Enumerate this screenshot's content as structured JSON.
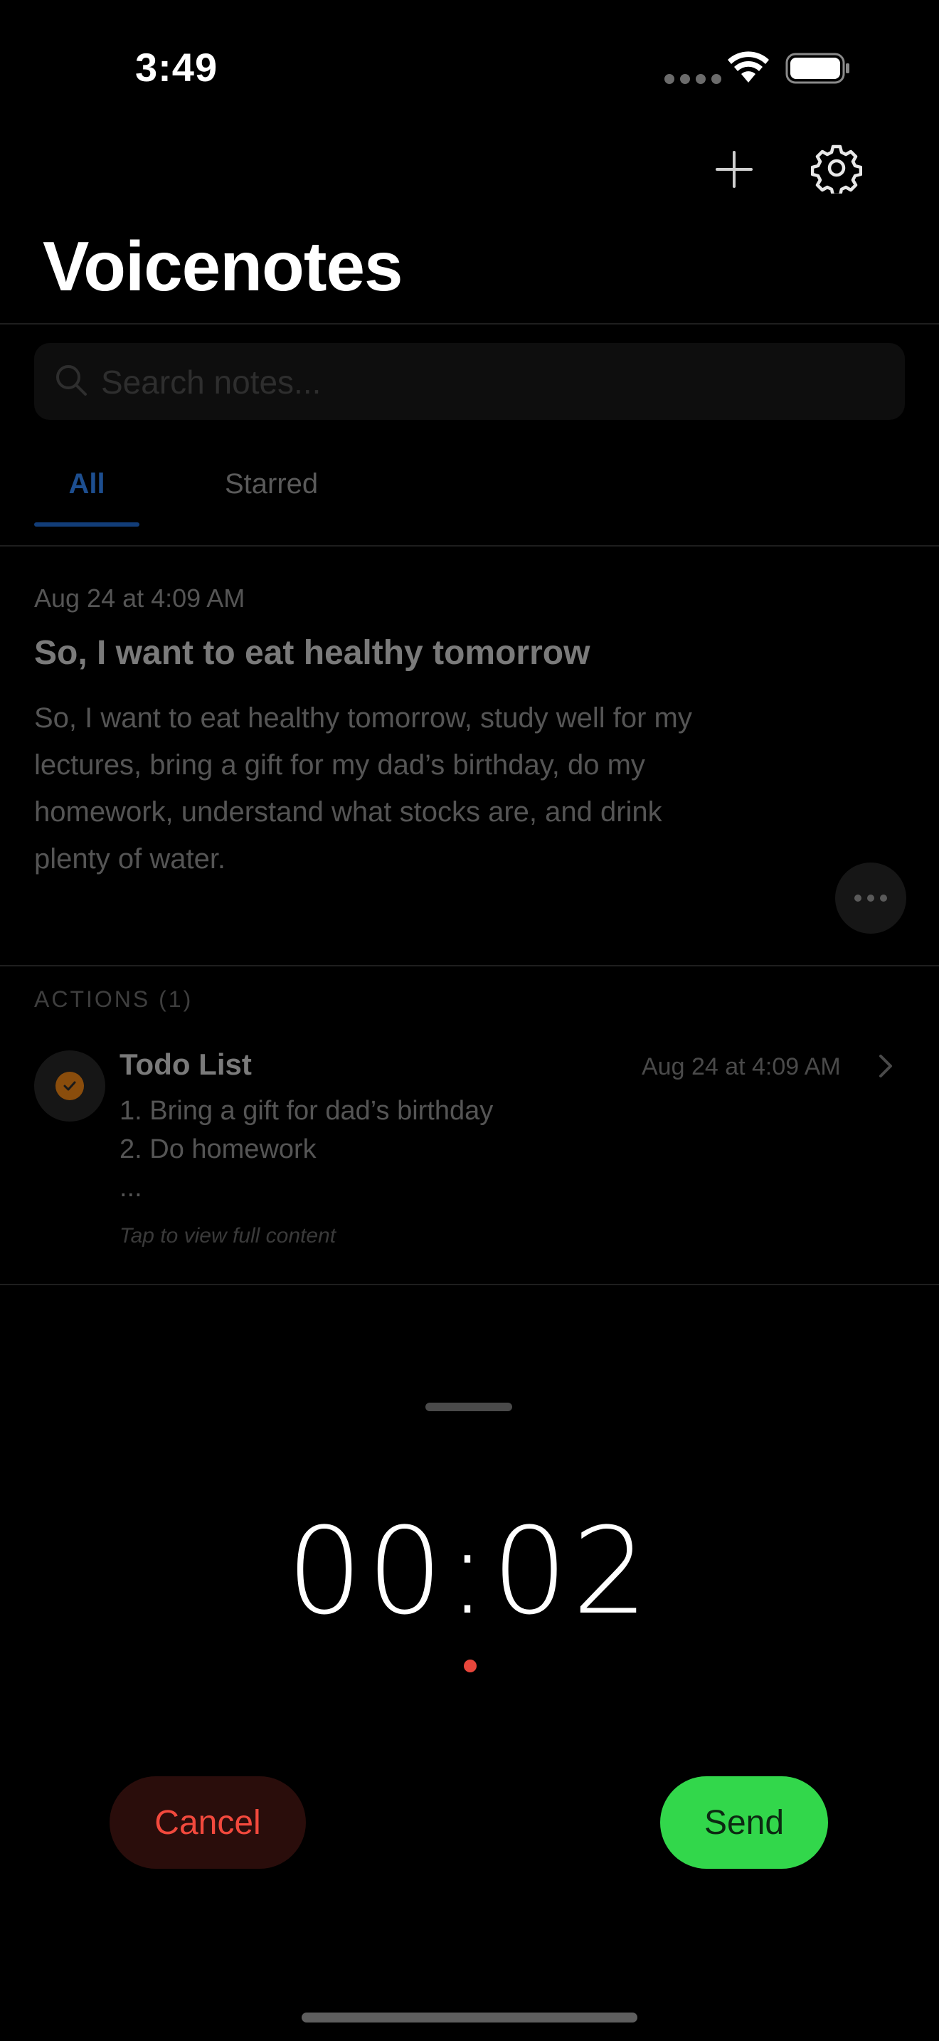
{
  "status_bar": {
    "time": "3:49"
  },
  "header": {
    "title": "Voicenotes",
    "add_icon": "plus-icon",
    "settings_icon": "gear-icon"
  },
  "search": {
    "placeholder": "Search notes...",
    "value": ""
  },
  "tabs": [
    {
      "label": "All",
      "active": true
    },
    {
      "label": "Starred",
      "active": false
    }
  ],
  "note": {
    "date": "Aug 24 at 4:09 AM",
    "title": "So, I want to eat healthy tomorrow",
    "body_lines": [
      "So, I want to eat healthy tomorrow, study well for my",
      "lectures, bring a gift for my dad’s birthday, do my",
      "homework, understand what stocks are, and drink",
      "plenty of water."
    ]
  },
  "actions": {
    "header": "ACTIONS (1)",
    "items": [
      {
        "title": "Todo List",
        "date": "Aug 24 at 4:09 AM",
        "lines": [
          "1. Bring a gift for dad’s birthday",
          "2. Do homework",
          "..."
        ],
        "hint": "Tap to view full content"
      }
    ]
  },
  "recorder": {
    "timer": "00:02",
    "cancel_label": "Cancel",
    "send_label": "Send"
  },
  "colors": {
    "accent_blue": "#1d4e8f",
    "cancel_text": "#f2493d",
    "send_bg": "#32d74b",
    "record_dot": "#e8463b",
    "todo_check": "#8a4d0c"
  }
}
